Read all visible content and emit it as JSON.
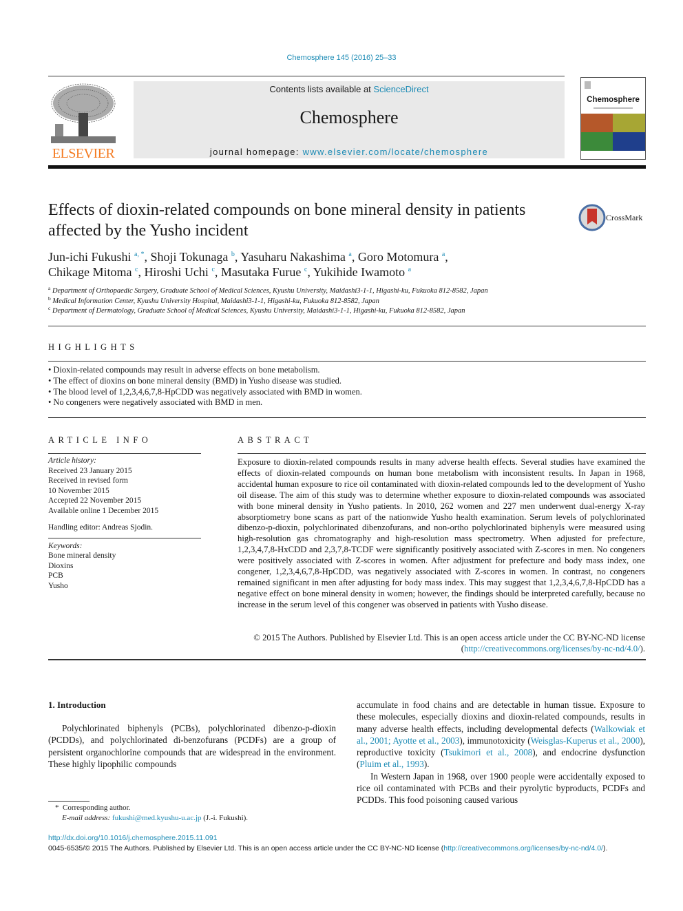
{
  "citation": "Chemosphere 145 (2016) 25–33",
  "header": {
    "publisher_logo_text": "ELSEVIER",
    "contents_prefix": "Contents lists available at ",
    "contents_link": "ScienceDirect",
    "journal_title": "Chemosphere",
    "homepage_prefix": "journal homepage: ",
    "homepage_link": "www.elsevier.com/locate/chemosphere",
    "cover_title": "Chemosphere"
  },
  "article": {
    "title": "Effects of dioxin-related compounds on bone mineral density in patients affected by the Yusho incident",
    "crossmark_label": "CrossMark",
    "authors": [
      {
        "name": "Jun-ichi Fukushi",
        "sup": "a, *",
        "sep": ", "
      },
      {
        "name": "Shoji Tokunaga",
        "sup": "b",
        "sep": ", "
      },
      {
        "name": "Yasuharu Nakashima",
        "sup": "a",
        "sep": ", "
      },
      {
        "name": "Goro Motomura",
        "sup": "a",
        "sep": ","
      },
      {
        "name": "Chikage Mitoma",
        "sup": "c",
        "sep": ", "
      },
      {
        "name": "Hiroshi Uchi",
        "sup": "c",
        "sep": ", "
      },
      {
        "name": "Masutaka Furue",
        "sup": "c",
        "sep": ", "
      },
      {
        "name": "Yukihide Iwamoto",
        "sup": "a",
        "sep": ""
      }
    ],
    "affiliations": [
      {
        "key": "a",
        "text": "Department of Orthopaedic Surgery, Graduate School of Medical Sciences, Kyushu University, Maidashi3-1-1, Higashi-ku, Fukuoka 812-8582, Japan"
      },
      {
        "key": "b",
        "text": "Medical Information Center, Kyushu University Hospital, Maidashi3-1-1, Higashi-ku, Fukuoka 812-8582, Japan"
      },
      {
        "key": "c",
        "text": "Department of Dermatology, Graduate School of Medical Sciences, Kyushu University, Maidashi3-1-1, Higashi-ku, Fukuoka 812-8582, Japan"
      }
    ]
  },
  "highlights": {
    "heading": "HIGHLIGHTS",
    "items": [
      "Dioxin-related compounds may result in adverse effects on bone metabolism.",
      "The effect of dioxins on bone mineral density (BMD) in Yusho disease was studied.",
      "The blood level of 1,2,3,4,6,7,8-HpCDD was negatively associated with BMD in women.",
      "No congeners were negatively associated with BMD in men."
    ]
  },
  "article_info": {
    "heading": "ARTICLE INFO",
    "history_label": "Article history:",
    "history": [
      "Received 23 January 2015",
      "Received in revised form",
      "10 November 2015",
      "Accepted 22 November 2015",
      "Available online 1 December 2015"
    ],
    "handling_editor": "Handling editor: Andreas Sjodin.",
    "keywords_label": "Keywords:",
    "keywords": [
      "Bone mineral density",
      "Dioxins",
      "PCB",
      "Yusho"
    ]
  },
  "abstract": {
    "heading": "ABSTRACT",
    "text": "Exposure to dioxin-related compounds results in many adverse health effects. Several studies have examined the effects of dioxin-related compounds on human bone metabolism with inconsistent results. In Japan in 1968, accidental human exposure to rice oil contaminated with dioxin-related compounds led to the development of Yusho oil disease. The aim of this study was to determine whether exposure to dioxin-related compounds was associated with bone mineral density in Yusho patients. In 2010, 262 women and 227 men underwent dual-energy X-ray absorptiometry bone scans as part of the nationwide Yusho health examination. Serum levels of polychlorinated dibenzo-p-dioxin, polychlorinated dibenzofurans, and non-ortho polychlorinated biphenyls were measured using high-resolution gas chromatography and high-resolution mass spectrometry. When adjusted for prefecture, 1,2,3,4,7,8-HxCDD and 2,3,7,8-TCDF were significantly positively associated with Z-scores in men. No congeners were positively associated with Z-scores in women. After adjustment for prefecture and body mass index, one congener, 1,2,3,4,6,7,8-HpCDD, was negatively associated with Z-scores in women. In contrast, no congeners remained significant in men after adjusting for body mass index. This may suggest that 1,2,3,4,6,7,8-HpCDD has a negative effect on bone mineral density in women; however, the findings should be interpreted carefully, because no increase in the serum level of this congener was observed in patients with Yusho disease.",
    "copyright_prefix": "© 2015 The Authors. Published by Elsevier Ltd. This is an open access article under the CC BY-NC-ND license (",
    "copyright_link": "http://creativecommons.org/licenses/by-nc-nd/4.0/",
    "copyright_suffix": ")."
  },
  "introduction": {
    "heading": "1.  Introduction",
    "p1": "Polychlorinated biphenyls (PCBs), polychlorinated dibenzo-p-dioxin (PCDDs), and polychlorinated di-benzofurans (PCDFs) are a group of persistent organochlorine compounds that are widespread in the environment. These highly lipophilic compounds",
    "col2_a": "accumulate in food chains and are detectable in human tissue. Exposure to these molecules, especially dioxins and dioxin-related compounds, results in many adverse health effects, including developmental defects (",
    "ref1": "Walkowiak et al., 2001; Ayotte et al., 2003",
    "col2_b": "), immunotoxicity (",
    "ref2": "Weisglas-Kuperus et al., 2000",
    "col2_c": "), reproductive toxicity (",
    "ref3": "Tsukimori et al., 2008",
    "col2_d": "), and endocrine dysfunction (",
    "ref4": "Pluim et al., 1993",
    "col2_e": ").",
    "p2": "In Western Japan in 1968, over 1900 people were accidentally exposed to rice oil contaminated with PCBs and their pyrolytic byproducts, PCDFs and PCDDs. This food poisoning caused various"
  },
  "footnote": {
    "star": "*",
    "corresponding": "Corresponding author.",
    "email_label": "E-mail address:",
    "email": "fukushi@med.kyushu-u.ac.jp",
    "email_suffix": " (J.-i. Fukushi)."
  },
  "footer": {
    "doi": "http://dx.doi.org/10.1016/j.chemosphere.2015.11.091",
    "license_prefix": "0045-6535/© 2015 The Authors. Published by Elsevier Ltd. This is an open access article under the CC BY-NC-ND license (",
    "license_link": "http://creativecommons.org/licenses/by-nc-nd/4.0/",
    "license_suffix": ")."
  },
  "colors": {
    "link": "#1c8bb5",
    "elsevier_orange": "#f47a20",
    "header_box": "#e9e9e9"
  }
}
